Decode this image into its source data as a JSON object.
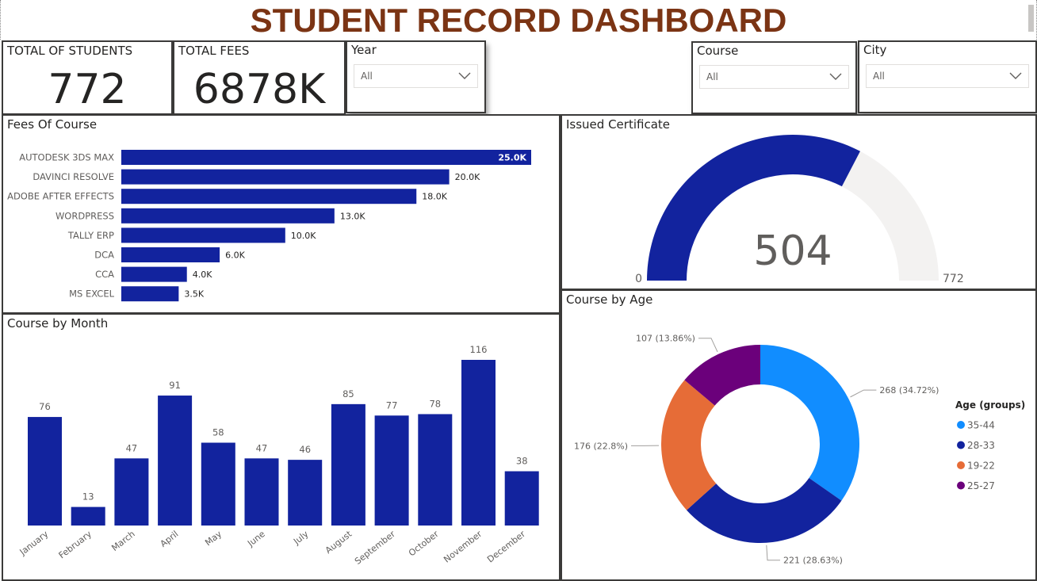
{
  "page_title": "STUDENT RECORD DASHBOARD",
  "kpis": {
    "students_label": "TOTAL OF STUDENTS",
    "students_value": "772",
    "fees_label": "TOTAL FEES",
    "fees_value": "6878K"
  },
  "slicers": {
    "year": {
      "label": "Year",
      "value": "All"
    },
    "course": {
      "label": "Course",
      "value": "All"
    },
    "city": {
      "label": "City",
      "value": "All"
    }
  },
  "colors": {
    "bar": "#12239e",
    "title": "#7b3414",
    "gauge_track": "#f3f2f1",
    "age_35_44": "#118dff",
    "age_28_33": "#12239e",
    "age_19_22": "#e66c37",
    "age_25_27": "#6b007b"
  },
  "chart_data": [
    {
      "id": "fees",
      "type": "bar",
      "orientation": "horizontal",
      "title": "Fees Of Course",
      "categories": [
        "AUTODESK 3DS MAX",
        "DAVINCI RESOLVE",
        "ADOBE AFTER EFFECTS",
        "WORDPRESS",
        "TALLY ERP",
        "DCA",
        "CCA",
        "MS EXCEL"
      ],
      "values": [
        25000,
        20000,
        18000,
        13000,
        10000,
        6000,
        4000,
        3500
      ],
      "labels": [
        "25.0K",
        "20.0K",
        "18.0K",
        "13.0K",
        "10.0K",
        "6.0K",
        "4.0K",
        "3.5K"
      ],
      "xlim": [
        0,
        25000
      ]
    },
    {
      "id": "certificate",
      "type": "gauge",
      "title": "Issued Certificate",
      "value": 504,
      "min": 0,
      "max": 772,
      "value_label": "504",
      "min_label": "0",
      "max_label": "772"
    },
    {
      "id": "month",
      "type": "bar",
      "title": "Course by Month",
      "categories": [
        "January",
        "February",
        "March",
        "April",
        "May",
        "June",
        "July",
        "August",
        "September",
        "October",
        "November",
        "December"
      ],
      "values": [
        76,
        13,
        47,
        91,
        58,
        47,
        46,
        85,
        77,
        78,
        116,
        38
      ],
      "ylim": [
        0,
        116
      ]
    },
    {
      "id": "age",
      "type": "pie",
      "donut": true,
      "title": "Course by Age",
      "legend_title": "Age (groups)",
      "legend_position": "right",
      "slices": [
        {
          "name": "35-44",
          "value": 268,
          "label": "268 (34.72%)",
          "color": "#118dff"
        },
        {
          "name": "28-33",
          "value": 221,
          "label": "221 (28.63%)",
          "color": "#12239e"
        },
        {
          "name": "19-22",
          "value": 176,
          "label": "176 (22.8%)",
          "color": "#e66c37"
        },
        {
          "name": "25-27",
          "value": 107,
          "label": "107 (13.86%)",
          "color": "#6b007b"
        }
      ]
    }
  ]
}
